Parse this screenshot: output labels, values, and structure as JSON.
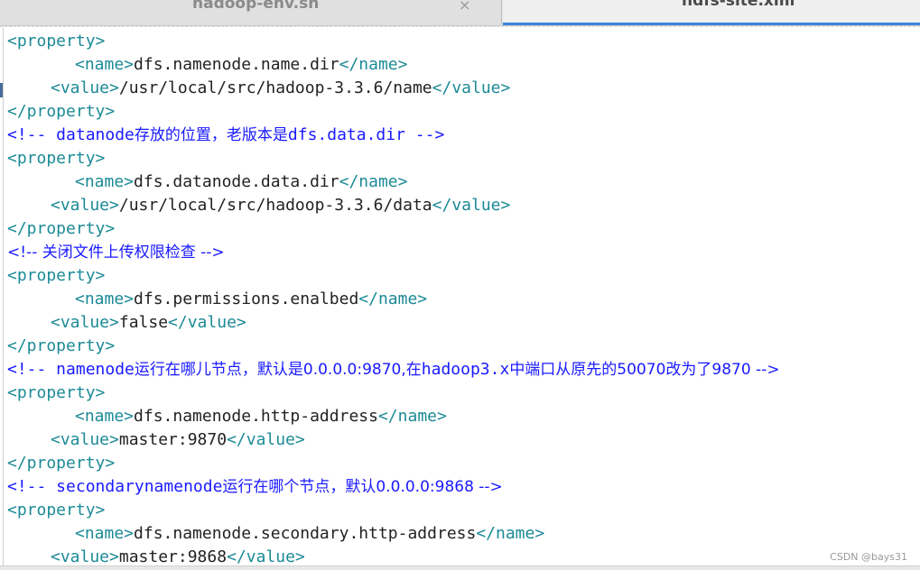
{
  "tabs": [
    {
      "label": "hadoop-env.sh",
      "active": false,
      "close_glyph": "×"
    },
    {
      "label": "hdfs-site.xml",
      "active": true
    }
  ],
  "editor": {
    "lines": [
      {
        "indent": 0,
        "kind": "tag",
        "segments": [
          {
            "t": "tag",
            "v": "<property>"
          }
        ]
      },
      {
        "indent": 3,
        "kind": "elem",
        "segments": [
          {
            "t": "tag",
            "v": "<name>"
          },
          {
            "t": "txt",
            "v": "dfs.namenode.name.dir"
          },
          {
            "t": "tag",
            "v": "</name>"
          }
        ]
      },
      {
        "indent": 2,
        "kind": "elem",
        "segments": [
          {
            "t": "tag",
            "v": "<value>"
          },
          {
            "t": "txt",
            "v": "/usr/local/src/hadoop-3.3.6/name"
          },
          {
            "t": "tag",
            "v": "</value>"
          }
        ]
      },
      {
        "indent": 0,
        "kind": "tag",
        "segments": [
          {
            "t": "tag",
            "v": "</property>"
          }
        ]
      },
      {
        "indent": 0,
        "kind": "comment",
        "segments": [
          {
            "t": "cmt",
            "v": "<!-- datanode"
          },
          {
            "t": "cmt-cjk",
            "v": "存放的位置，老版本是"
          },
          {
            "t": "cmt",
            "v": "dfs.data.dir -->"
          }
        ]
      },
      {
        "indent": 0,
        "kind": "tag",
        "segments": [
          {
            "t": "tag",
            "v": "<property>"
          }
        ]
      },
      {
        "indent": 3,
        "kind": "elem",
        "segments": [
          {
            "t": "tag",
            "v": "<name>"
          },
          {
            "t": "txt",
            "v": "dfs.datanode.data.dir"
          },
          {
            "t": "tag",
            "v": "</name>"
          }
        ]
      },
      {
        "indent": 2,
        "kind": "elem",
        "segments": [
          {
            "t": "tag",
            "v": "<value>"
          },
          {
            "t": "txt",
            "v": "/usr/local/src/hadoop-3.3.6/data"
          },
          {
            "t": "tag",
            "v": "</value>"
          }
        ]
      },
      {
        "indent": 0,
        "kind": "tag",
        "segments": [
          {
            "t": "tag",
            "v": "</property>"
          }
        ]
      },
      {
        "indent": 0,
        "kind": "comment",
        "segments": [
          {
            "t": "cmt-cjk",
            "v": "<!-- 关闭文件上传权限检查 -->"
          }
        ]
      },
      {
        "indent": 0,
        "kind": "tag",
        "segments": [
          {
            "t": "tag",
            "v": "<property>"
          }
        ]
      },
      {
        "indent": 3,
        "kind": "elem",
        "segments": [
          {
            "t": "tag",
            "v": "<name>"
          },
          {
            "t": "txt",
            "v": "dfs.permissions.enalbed"
          },
          {
            "t": "tag",
            "v": "</name>"
          }
        ]
      },
      {
        "indent": 2,
        "kind": "elem",
        "segments": [
          {
            "t": "tag",
            "v": "<value>"
          },
          {
            "t": "txt",
            "v": "false"
          },
          {
            "t": "tag",
            "v": "</value>"
          }
        ]
      },
      {
        "indent": 0,
        "kind": "tag",
        "segments": [
          {
            "t": "tag",
            "v": "</property>"
          }
        ]
      },
      {
        "indent": 0,
        "kind": "comment",
        "segments": [
          {
            "t": "cmt",
            "v": "<!-- namenode"
          },
          {
            "t": "cmt-cjk",
            "v": "运行在哪儿节点，默认是0.0.0.0:9870,在"
          },
          {
            "t": "cmt",
            "v": "hadoop3.x"
          },
          {
            "t": "cmt-cjk",
            "v": "中端口从原先的50070改为了9870 -->"
          }
        ]
      },
      {
        "indent": 0,
        "kind": "tag",
        "segments": [
          {
            "t": "tag",
            "v": "<property>"
          }
        ]
      },
      {
        "indent": 3,
        "kind": "elem",
        "segments": [
          {
            "t": "tag",
            "v": "<name>"
          },
          {
            "t": "txt",
            "v": "dfs.namenode.http-address"
          },
          {
            "t": "tag",
            "v": "</name>"
          }
        ]
      },
      {
        "indent": 2,
        "kind": "elem",
        "segments": [
          {
            "t": "tag",
            "v": "<value>"
          },
          {
            "t": "txt",
            "v": "master:9870"
          },
          {
            "t": "tag",
            "v": "</value>"
          }
        ]
      },
      {
        "indent": 0,
        "kind": "tag",
        "segments": [
          {
            "t": "tag",
            "v": "</property>"
          }
        ]
      },
      {
        "indent": 0,
        "kind": "comment",
        "segments": [
          {
            "t": "cmt",
            "v": "<!-- secondarynamenode"
          },
          {
            "t": "cmt-cjk",
            "v": "运行在哪个节点，默认0.0.0.0:9868 -->"
          }
        ]
      },
      {
        "indent": 0,
        "kind": "tag",
        "segments": [
          {
            "t": "tag",
            "v": "<property>"
          }
        ]
      },
      {
        "indent": 3,
        "kind": "elem",
        "segments": [
          {
            "t": "tag",
            "v": "<name>"
          },
          {
            "t": "txt",
            "v": "dfs.namenode.secondary.http-address"
          },
          {
            "t": "tag",
            "v": "</name>"
          }
        ]
      },
      {
        "indent": 2,
        "kind": "elem",
        "segments": [
          {
            "t": "tag",
            "v": "<value>"
          },
          {
            "t": "txt",
            "v": "master:9868"
          },
          {
            "t": "tag",
            "v": "</value>"
          }
        ]
      }
    ]
  },
  "watermark": "CSDN @bays31",
  "colors": {
    "tag": "#1c8a96",
    "text": "#222222",
    "comment": "#1a1aff",
    "active_tab_underline": "#3c86d8"
  }
}
